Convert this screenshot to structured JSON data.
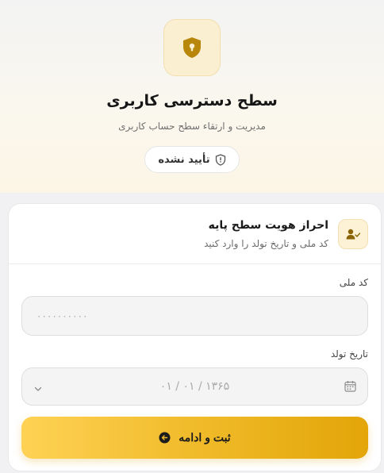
{
  "header": {
    "title": "سطح دسترسی کاربری",
    "subtitle": "مدیریت و ارتقاء سطح حساب کاربری",
    "status_badge": "تأیید نشده",
    "icon": "shield-lock-icon"
  },
  "card": {
    "title": "احراز هویت سطح پایه",
    "subtitle": "کد ملی و تاریخ تولد را وارد کنید",
    "icon": "user-check-icon",
    "national_id": {
      "label": "کد ملی",
      "placeholder": "۰۰۰۰۰۰۰۰۰۰",
      "value": ""
    },
    "birth_date": {
      "label": "تاریخ تولد",
      "placeholder": "۰۱ / ۰۱ / ۱۳۶۵",
      "value": ""
    },
    "submit_label": "ثبت و ادامه"
  },
  "colors": {
    "accent": "#e3a508",
    "accent_light": "#ffd255",
    "icon_bg": "#fbefd2"
  }
}
